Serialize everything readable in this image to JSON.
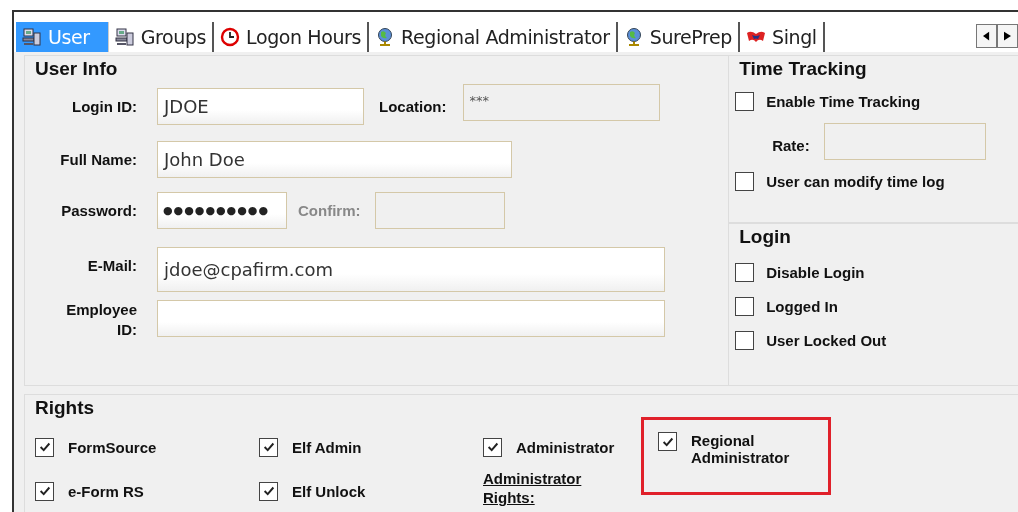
{
  "tabs": [
    {
      "label": "User",
      "selected": true
    },
    {
      "label": "Groups",
      "selected": false
    },
    {
      "label": "Logon Hours",
      "selected": false
    },
    {
      "label": "Regional Administrator",
      "selected": false
    },
    {
      "label": "SurePrep",
      "selected": false
    },
    {
      "label": "Singl",
      "selected": false
    }
  ],
  "user_info": {
    "title": "User Info",
    "login_id": {
      "label": "Login ID:",
      "value": "JDOE"
    },
    "location": {
      "label": "Location:",
      "value": "***",
      "disabled": true
    },
    "full_name": {
      "label": "Full Name:",
      "value": "John Doe"
    },
    "password": {
      "label": "Password:",
      "value": "●●●●●●●●●●"
    },
    "confirm": {
      "label": "Confirm:",
      "disabled": true
    },
    "email": {
      "label": "E-Mail:",
      "value": "jdoe@cpafirm.com"
    },
    "employee_id": {
      "label": "Employee ID:"
    }
  },
  "time_tracking": {
    "title": "Time Tracking",
    "enable": {
      "label": "Enable Time Tracking",
      "checked": false
    },
    "rate": {
      "label": "Rate:"
    },
    "modify": {
      "label": "User can modify time log",
      "checked": false
    }
  },
  "login": {
    "title": "Login",
    "options": [
      {
        "label": "Disable Login",
        "checked": false
      },
      {
        "label": "Logged In",
        "checked": false
      },
      {
        "label": "User Locked Out",
        "checked": false
      }
    ]
  },
  "rights": {
    "title": "Rights",
    "items": [
      {
        "label": "FormSource",
        "checked": true,
        "highlighted": false
      },
      {
        "label": "Elf Admin",
        "checked": true,
        "highlighted": false
      },
      {
        "label": "Administrator",
        "checked": true,
        "highlighted": false
      },
      {
        "label": "Regional Administrator",
        "checked": true,
        "highlighted": true
      },
      {
        "label": "e-Form RS",
        "checked": true,
        "highlighted": false
      },
      {
        "label": "Elf Unlock",
        "checked": true,
        "highlighted": false
      }
    ],
    "link": "Administrator Rights:"
  }
}
